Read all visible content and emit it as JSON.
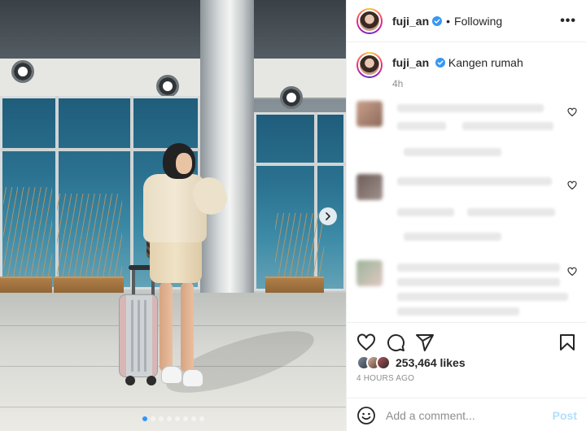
{
  "post": {
    "username": "fuji_an",
    "follow_separator": "•",
    "follow_status": "Following",
    "more_label": "•••",
    "caption": "Kangen rumah",
    "caption_time": "4h",
    "likes": "253,464 likes",
    "time_ago": "4 HOURS AGO"
  },
  "carousel": {
    "slide_count": 8,
    "active_index": 0
  },
  "comment_box": {
    "placeholder": "Add a comment...",
    "post_label": "Post"
  },
  "colors": {
    "accent": "#0095f6",
    "post_disabled": "#b2dffc",
    "verified": "#3897f0",
    "muted": "#8e8e8e"
  },
  "icons": [
    "verified-badge-icon",
    "more-options-icon",
    "chevron-right-icon",
    "heart-icon",
    "comment-icon",
    "share-icon",
    "bookmark-icon",
    "emoji-icon"
  ]
}
